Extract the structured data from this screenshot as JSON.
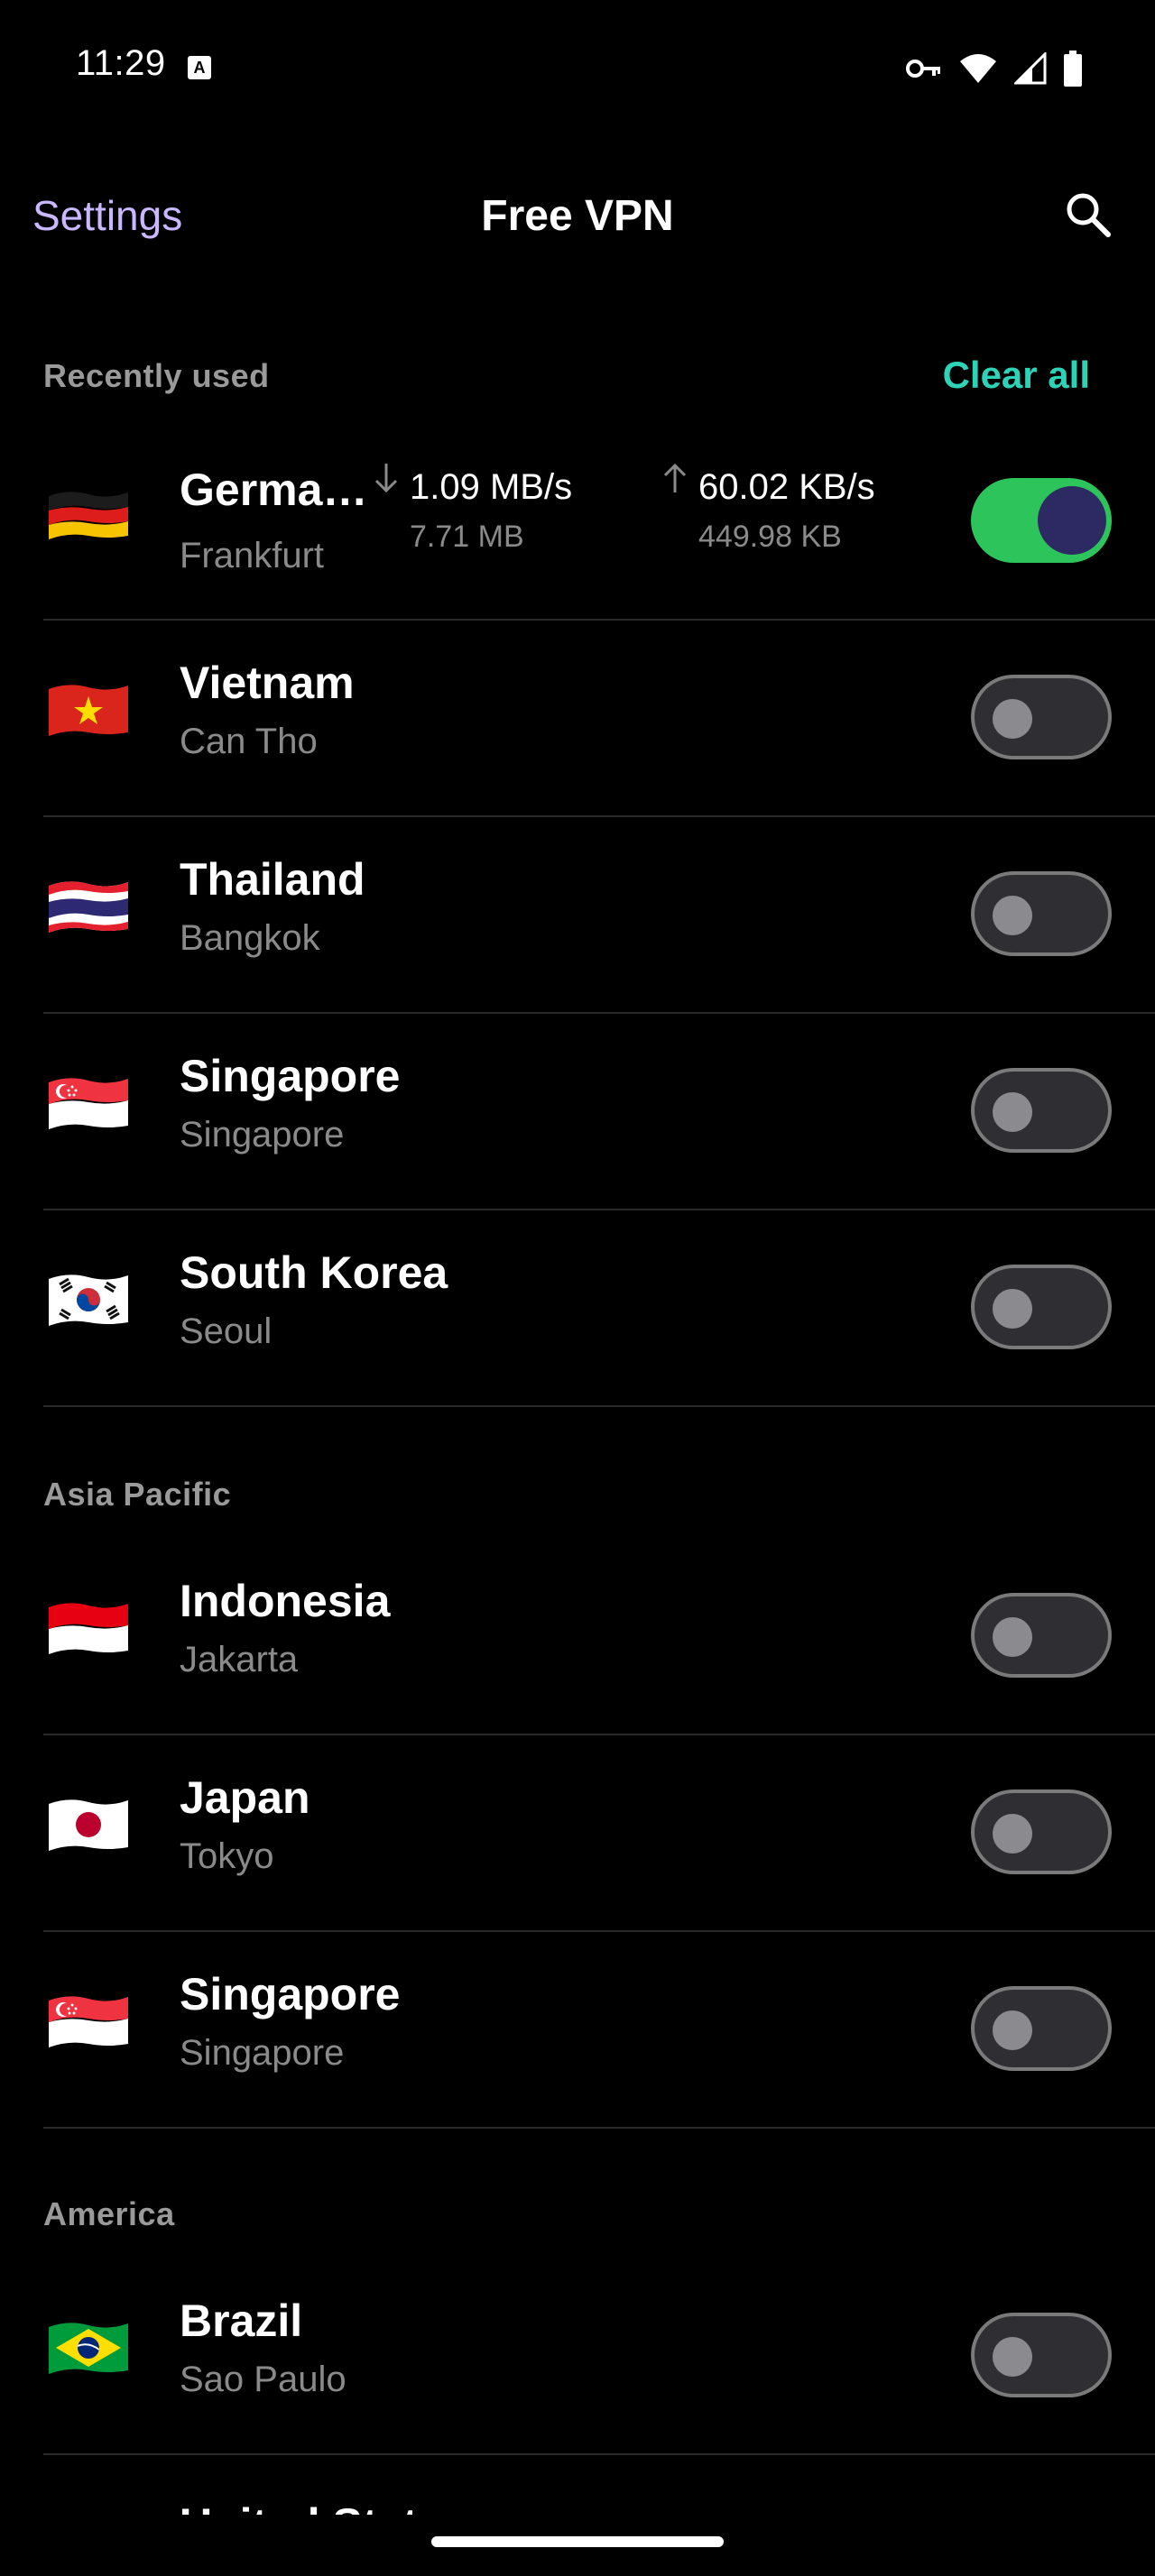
{
  "status_bar": {
    "time": "11:29",
    "notification_icon": "a-box-icon",
    "icons": [
      "vpn-key-icon",
      "wifi-icon",
      "signal-icon",
      "battery-icon"
    ]
  },
  "app_bar": {
    "settings_label": "Settings",
    "title": "Free VPN",
    "search_icon": "search-icon"
  },
  "colors": {
    "accent_settings": "#c9b8ff",
    "accent_clear": "#2ed3b7",
    "toggle_on": "#2ec45c"
  },
  "recently_used": {
    "header": "Recently used",
    "clear_all_label": "Clear all",
    "items": [
      {
        "country": "Germa…",
        "city": "Frankfurt",
        "flag": "germany-flag",
        "connected": true,
        "download_rate": "1.09 MB/s",
        "download_total": "7.71 MB",
        "upload_rate": "60.02 KB/s",
        "upload_total": "449.98 KB"
      },
      {
        "country": "Vietnam",
        "city": "Can Tho",
        "flag": "vietnam-flag",
        "connected": false
      },
      {
        "country": "Thailand",
        "city": "Bangkok",
        "flag": "thailand-flag",
        "connected": false
      },
      {
        "country": "Singapore",
        "city": "Singapore",
        "flag": "singapore-flag",
        "connected": false
      },
      {
        "country": "South Korea",
        "city": "Seoul",
        "flag": "south-korea-flag",
        "connected": false
      }
    ]
  },
  "asia_pacific": {
    "header": "Asia Pacific",
    "items": [
      {
        "country": "Indonesia",
        "city": "Jakarta",
        "flag": "indonesia-flag",
        "connected": false
      },
      {
        "country": "Japan",
        "city": "Tokyo",
        "flag": "japan-flag",
        "connected": false
      },
      {
        "country": "Singapore",
        "city": "Singapore",
        "flag": "singapore-flag",
        "connected": false
      }
    ]
  },
  "america": {
    "header": "America",
    "items": [
      {
        "country": "Brazil",
        "city": "Sao Paulo",
        "flag": "brazil-flag",
        "connected": false
      }
    ],
    "partial_next_item": "United States"
  }
}
